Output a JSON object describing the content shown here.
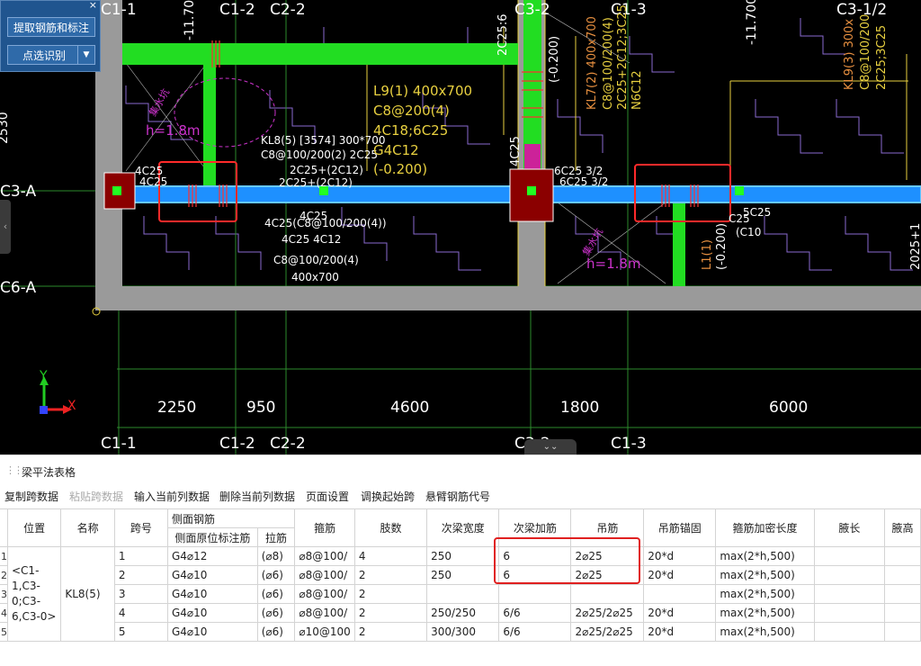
{
  "panel": {
    "close_label": "×",
    "extract_button": "提取钢筋和标注",
    "select_button": "点选识别",
    "select_arrow": "▼"
  },
  "nav": {
    "left_tab": "‹",
    "collapse_tab": "⌄⌄"
  },
  "cad": {
    "axes_top": [
      "C1-1",
      "C1-2",
      "C2-2",
      "C3-2",
      "C1-3",
      "C3-1/2"
    ],
    "axes_bottom": [
      "C1-1",
      "C1-2",
      "C2-2",
      "C3-2",
      "C1-3"
    ],
    "axes_left": [
      "C3-A",
      "C6-A"
    ],
    "dims": [
      "2250",
      "950",
      "4600",
      "1800",
      "6000"
    ],
    "ucs_y": "Y",
    "ucs_x": "X",
    "elev_1": "-11.700",
    "elev_2": "-11.700",
    "kl7": "KL7(2) 400x700",
    "kl7_b": "C8@100/200(4)",
    "kl7_c": "2C25+2C12;3C25",
    "kl7_d": "N6C12",
    "kl8": "KL8(5) [3574] 300*700",
    "kl8_b": "C8@100/200(2) 2C25",
    "kl8_c": "2C25+(2C12)",
    "l9_a": "L9(1) 400x700",
    "l9_b": "C8@200(4)",
    "l9_c": "4C18;6C25",
    "l9_d": "G4C12",
    "l9_e": "(-0.200)",
    "kl9_a": "KL9(3) 300x",
    "kl9_b": "C8@100/200",
    "kl9_c": "2C25;3C25",
    "b1": "4C25",
    "b2": "4C25",
    "b3": "4C25",
    "b4": "4C25(C8@100/200(4))",
    "b5": "4C25",
    "b6": "4C12",
    "b7": "4C25 4C12",
    "b8": "C8@100/200(4)",
    "b9": "400x700",
    "b10": "2C25:6",
    "b11": "(-0.200)",
    "b12": "4C25",
    "b13": "6C25 3/2",
    "b14": "5C25",
    "b15": "C25",
    "b16": "(C10",
    "b17": "L1(1)",
    "b18": "(-0.200)",
    "slab1": "集水坑",
    "slab1_h": "h=1.8m",
    "slab2": "集水坑",
    "slab2_h": "h=1.8m",
    "left_partial": "2530",
    "right_partial": "2025+1"
  },
  "lower": {
    "title": "梁平法表格",
    "toolbar": [
      {
        "label": "复制跨数据",
        "disabled": false
      },
      {
        "label": "粘贴跨数据",
        "disabled": true
      },
      {
        "label": "输入当前列数据",
        "disabled": false
      },
      {
        "label": "删除当前列数据",
        "disabled": false
      },
      {
        "label": "页面设置",
        "disabled": false
      },
      {
        "label": "调换起始跨",
        "disabled": false
      },
      {
        "label": "悬臂钢筋代号",
        "disabled": false
      }
    ],
    "headers": {
      "position": "位置",
      "name": "名称",
      "span": "跨号",
      "side_group": "侧面钢筋",
      "side_original": "侧面原位标注筋",
      "tie": "拉筋",
      "stirrup": "箍筋",
      "legs": "肢数",
      "sec_width": "次梁宽度",
      "sec_add": "次梁加筋",
      "hanger": "吊筋",
      "hanger_anchor": "吊筋锚固",
      "dense_len": "箍筋加密长度",
      "haunch_len": "腋长",
      "haunch_h": "腋高"
    },
    "position_value": "<C1-1,C3-0;C3-6,C3-0>",
    "name_value": "KL8(5)",
    "rows": [
      {
        "idx": "1",
        "span": "1",
        "side": "G4⌀12",
        "tie": "(⌀8)",
        "stirrup": "⌀8@100/",
        "legs": "4",
        "sec_width": "250",
        "sec_add": "6",
        "hanger": "2⌀25",
        "anchor": "20*d",
        "dense": "max(2*h,500)"
      },
      {
        "idx": "2",
        "span": "2",
        "side": "G4⌀10",
        "tie": "(⌀6)",
        "stirrup": "⌀8@100/",
        "legs": "2",
        "sec_width": "250",
        "sec_add": "6",
        "hanger": "2⌀25",
        "anchor": "20*d",
        "dense": "max(2*h,500)"
      },
      {
        "idx": "3",
        "span": "3",
        "side": "G4⌀10",
        "tie": "(⌀6)",
        "stirrup": "⌀8@100/",
        "legs": "2",
        "sec_width": "",
        "sec_add": "",
        "hanger": "",
        "anchor": "",
        "dense": "max(2*h,500)"
      },
      {
        "idx": "4",
        "span": "4",
        "side": "G4⌀10",
        "tie": "(⌀6)",
        "stirrup": "⌀8@100/",
        "legs": "2",
        "sec_width": "250/250",
        "sec_add": "6/6",
        "hanger": "2⌀25/2⌀25",
        "anchor": "20*d",
        "dense": "max(2*h,500)"
      },
      {
        "idx": "5",
        "span": "5",
        "side": "G4⌀10",
        "tie": "(⌀6)",
        "stirrup": "⌀10@100",
        "legs": "2",
        "sec_width": "300/300",
        "sec_add": "6/6",
        "hanger": "2⌀25/2⌀25",
        "anchor": "20*d",
        "dense": "max(2*h,500)"
      }
    ]
  }
}
